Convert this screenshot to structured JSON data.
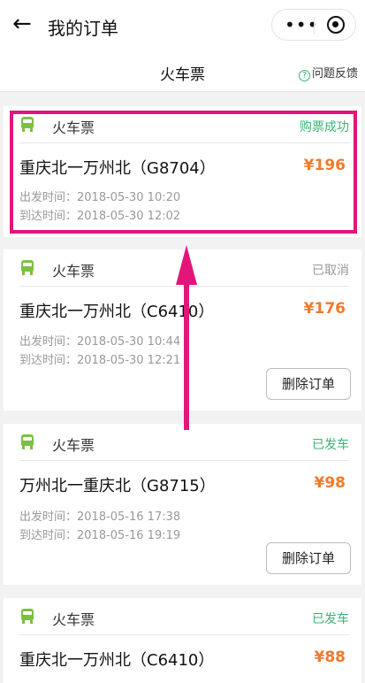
{
  "nav": {
    "back_icon": "arrow-left-icon",
    "title": "我的订单",
    "more_icon": "more-dots-icon",
    "close_icon": "target-icon"
  },
  "subheader": {
    "title": "火车票",
    "feedback_label": "问题反馈",
    "feedback_icon": "question-icon"
  },
  "colors": {
    "success": "#3cb371",
    "cancelled": "#999999",
    "price": "#f07a2c",
    "train_icon": "#7ac143",
    "highlight": "#e2157a"
  },
  "orders": [
    {
      "type": "火车票",
      "status": "购票成功",
      "route": "重庆北一万州北（G8704）",
      "price": "¥196",
      "depart": "出发时间：2018-05-30 10:20",
      "arrive": "到达时间：2018-05-30 12:02"
    },
    {
      "type": "火车票",
      "status": "已取消",
      "route": "重庆北一万州北（C6410）",
      "price": "¥176",
      "depart": "出发时间：2018-05-30 10:44",
      "arrive": "到达时间：2018-05-30 12:21",
      "action": "删除订单"
    },
    {
      "type": "火车票",
      "status": "已发车",
      "route": "万州北一重庆北（G8715）",
      "price": "¥98",
      "depart": "出发时间：2018-05-16 17:38",
      "arrive": "到达时间：2018-05-16 19:19",
      "action": "删除订单"
    },
    {
      "type": "火车票",
      "status": "已发车",
      "route": "重庆北一万州北（C6410）",
      "price": "¥88"
    }
  ]
}
